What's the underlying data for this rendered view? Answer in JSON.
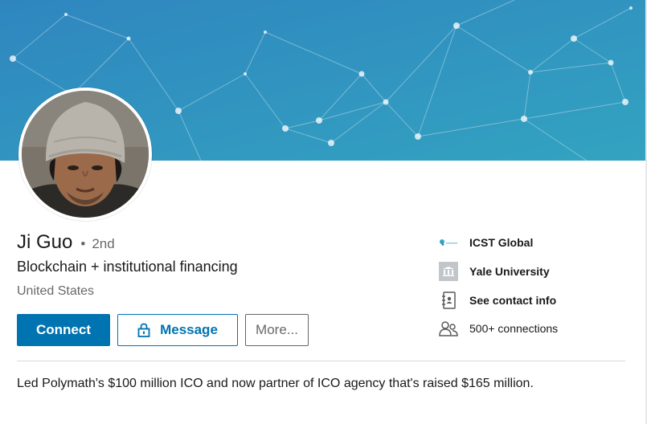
{
  "banner": {
    "color_top": "#2e87bd",
    "color_bottom": "#2ea6bd"
  },
  "profile": {
    "name": "Ji Guo",
    "degree_separator": "•",
    "degree": "2nd",
    "headline": "Blockchain + institutional financing",
    "location": "United States"
  },
  "actions": {
    "connect_label": "Connect",
    "message_label": "Message",
    "message_icon": "lock-icon",
    "more_label": "More..."
  },
  "side": {
    "company": {
      "label": "ICST Global",
      "icon": "icst-global-logo"
    },
    "school": {
      "label": "Yale University",
      "icon": "university-building-icon"
    },
    "contact": {
      "label": "See contact info",
      "icon": "address-book-icon"
    },
    "connections": {
      "label": "500+ connections",
      "icon": "people-icon"
    }
  },
  "summary": "Led Polymath's $100 million ICO and now partner of ICO agency that's raised $165 million.",
  "colors": {
    "primary": "#0073b1",
    "text": "#191919",
    "muted": "#666666"
  }
}
